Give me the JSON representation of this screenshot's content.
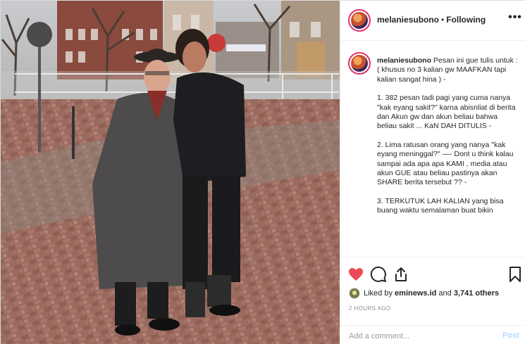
{
  "post": {
    "username": "melaniesubono",
    "separator": "•",
    "follow_status": "Following",
    "more_label": "•••",
    "caption_paragraphs": [
      "Pesan ini gue tulis untuk :( khusus no 3 kalian gw MAAFKAN tapi kalian sangat hina ) -",
      "1. 382 pesan tadi pagi yang cuma nanya \"kak eyang sakit?\" karna abisnliat di berita dan Akun gw dan akun beliau bahwa beliau sakit ... KaN DAH DITULIS -",
      "2. Lima ratusan orang yang nanya \"kak eyang meninggal?\" —- Dont u think kalau sampai ada apa apa KAMI , media atau akun GUE atau beliau pastinya akan SHARE berita tersebut ?? -",
      "3. TERKUTUK LAH KALIAN yang bisa buang waktu semalaman buat bikin"
    ],
    "likes": {
      "prefix": "Liked by ",
      "first_user": "eminews.id",
      "middle": " and ",
      "others": "3,741 others"
    },
    "timestamp": "2 HOURS AGO",
    "comment_placeholder": "Add a comment...",
    "post_button": "Post"
  },
  "icons": {
    "heart": "heart-icon",
    "comment": "comment-icon",
    "share": "share-icon",
    "bookmark": "bookmark-icon",
    "more": "more-icon"
  },
  "colors": {
    "heart_liked": "#ed4956",
    "post_disabled": "#b3dbff",
    "story_ring": "#e1306c",
    "muted": "#8e8e8e"
  }
}
